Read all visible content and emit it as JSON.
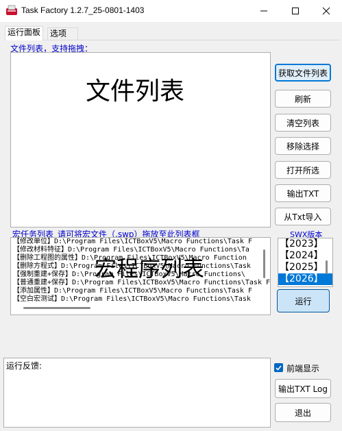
{
  "window": {
    "title": "Task Factory 1.2.7_25-0801-1403"
  },
  "tabs": [
    "运行面板",
    "选项"
  ],
  "file_list": {
    "label": "文件列表，支持拖拽：",
    "watermark": "文件列表"
  },
  "file_buttons": [
    "获取文件列表",
    "刷新",
    "清空列表",
    "移除选择",
    "打开所选",
    "输出TXT",
    "从Txt导入"
  ],
  "macro_list": {
    "label": "宏任务列表_请可将宏文件（.swp）拖放至此列表框",
    "watermark": "宏程序列表",
    "rows": [
      "【修改单位】D:\\Program Files\\ICTBoxV5\\Macro Functions\\Task F",
      "【修改材料特征】D:\\Program Files\\ICTBoxV5\\Macro Functions\\Ta",
      "【删除工程图的属性】D:\\Program Files\\ICTBoxV5\\Macro Function",
      "【删除方程式】D:\\Program Files\\ICTBoxV5\\Macro Functions\\Task",
      "【强制重建+保存】D:\\Program Files\\ICTBoxV5\\Macro Functions\\",
      "【普通重建+保存】D:\\Program Files\\ICTBoxV5\\Macro Functions\\Task F",
      "【添加属性】D:\\Program Files\\ICTBoxV5\\Macro Functions\\Task F",
      "【空白宏测试】D:\\Program Files\\ICTBoxV5\\Macro Functions\\Task"
    ]
  },
  "swx": {
    "label": "SWX版本",
    "versions": [
      "【2023】",
      "【2024】",
      "【2025】",
      "【2026】"
    ],
    "selected_index": 3
  },
  "run_button": "运行",
  "feedback": {
    "label": "运行反馈:"
  },
  "front_display": {
    "label": "前端显示",
    "checked": true
  },
  "export_log_button": "输出TXT Log",
  "exit_button": "退出",
  "colors": {
    "accent": "#0078d4",
    "label_blue": "#0000cc"
  }
}
